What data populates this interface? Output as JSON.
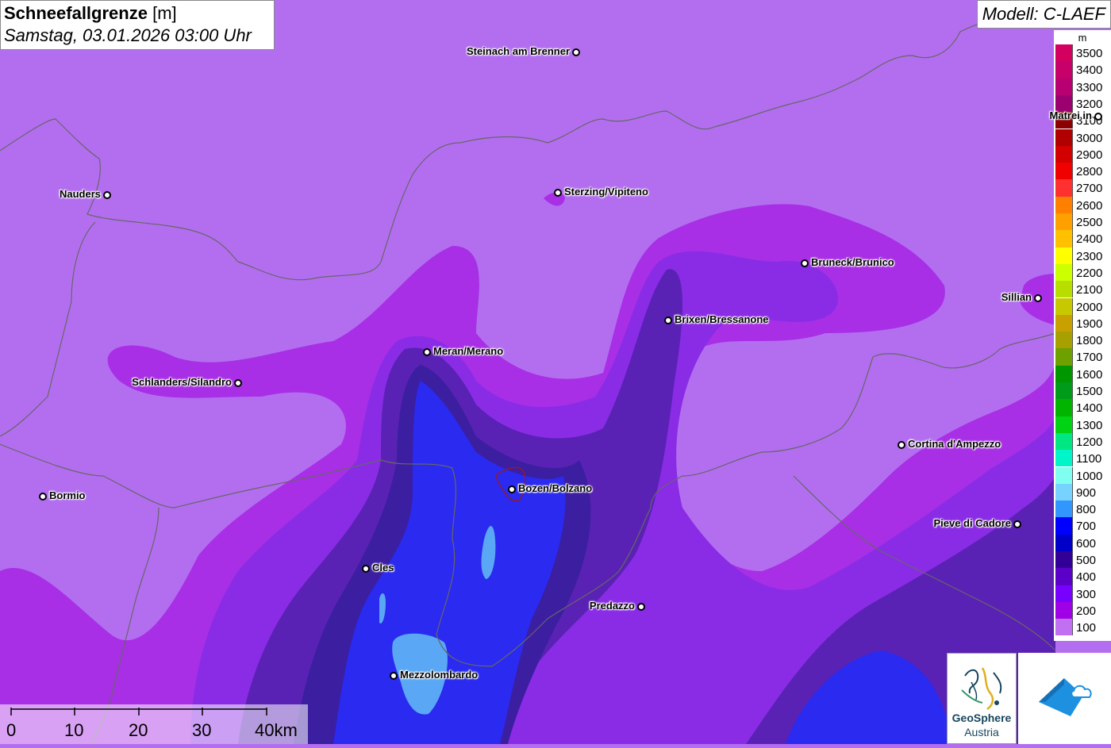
{
  "title": {
    "main": "Schneefallgrenze",
    "unit": "[m]",
    "subtitle": "Samstag, 03.01.2026 03:00 Uhr"
  },
  "model": "Modell: C-LAEF",
  "legend": {
    "unit": "m",
    "items": [
      {
        "label": "3500",
        "color": "#d4005f"
      },
      {
        "label": "3400",
        "color": "#c8006a"
      },
      {
        "label": "3300",
        "color": "#b80072"
      },
      {
        "label": "3200",
        "color": "#9c0070"
      },
      {
        "label": "3100",
        "color": "#8b0000"
      },
      {
        "label": "3000",
        "color": "#b00000"
      },
      {
        "label": "2900",
        "color": "#d30000"
      },
      {
        "label": "2800",
        "color": "#f00000"
      },
      {
        "label": "2700",
        "color": "#ff3030"
      },
      {
        "label": "2600",
        "color": "#ff8000"
      },
      {
        "label": "2500",
        "color": "#ff9f00"
      },
      {
        "label": "2400",
        "color": "#ffc000"
      },
      {
        "label": "2300",
        "color": "#ffff00"
      },
      {
        "label": "2200",
        "color": "#ccff00"
      },
      {
        "label": "2100",
        "color": "#b8dd00"
      },
      {
        "label": "2000",
        "color": "#c8c800"
      },
      {
        "label": "1900",
        "color": "#c8a000"
      },
      {
        "label": "1800",
        "color": "#a8a000"
      },
      {
        "label": "1700",
        "color": "#6ea000"
      },
      {
        "label": "1600",
        "color": "#009600"
      },
      {
        "label": "1500",
        "color": "#009b1a"
      },
      {
        "label": "1400",
        "color": "#00b400"
      },
      {
        "label": "1300",
        "color": "#00d214"
      },
      {
        "label": "1200",
        "color": "#00e682"
      },
      {
        "label": "1100",
        "color": "#00f5c8"
      },
      {
        "label": "1000",
        "color": "#80fff0"
      },
      {
        "label": "900",
        "color": "#78d2ff"
      },
      {
        "label": "800",
        "color": "#3296ff"
      },
      {
        "label": "700",
        "color": "#0000ff"
      },
      {
        "label": "600",
        "color": "#0000c8"
      },
      {
        "label": "500",
        "color": "#320096"
      },
      {
        "label": "400",
        "color": "#5a00c8"
      },
      {
        "label": "300",
        "color": "#7800ff"
      },
      {
        "label": "200",
        "color": "#a000e6"
      },
      {
        "label": "100",
        "color": "#c070f0"
      }
    ]
  },
  "cities": [
    {
      "name": "Steinach am Brenner",
      "label_side": "left"
    },
    {
      "name": "Matrei in",
      "label_side": "left"
    },
    {
      "name": "Nauders",
      "label_side": "left"
    },
    {
      "name": "Sterzing/Vipiteno",
      "label_side": "right"
    },
    {
      "name": "Bruneck/Brunico",
      "label_side": "right"
    },
    {
      "name": "Sillian",
      "label_side": "left"
    },
    {
      "name": "Brixen/Bressanone",
      "label_side": "right"
    },
    {
      "name": "Meran/Merano",
      "label_side": "right"
    },
    {
      "name": "Schlanders/Silandro",
      "label_side": "left"
    },
    {
      "name": "Cortina d'Ampezzo",
      "label_side": "right"
    },
    {
      "name": "Bormio",
      "label_side": "right"
    },
    {
      "name": "Bozen/Bolzano",
      "label_side": "right"
    },
    {
      "name": "Pieve di Cadore",
      "label_side": "left"
    },
    {
      "name": "Cles",
      "label_side": "right"
    },
    {
      "name": "Predazzo",
      "label_side": "left"
    },
    {
      "name": "Mezzolombardo",
      "label_side": "right"
    }
  ],
  "scale_bar": {
    "labels": [
      "0",
      "10",
      "20",
      "30",
      "40km"
    ]
  },
  "logo": {
    "line1": "GeoSphere",
    "line2": "Austria"
  }
}
